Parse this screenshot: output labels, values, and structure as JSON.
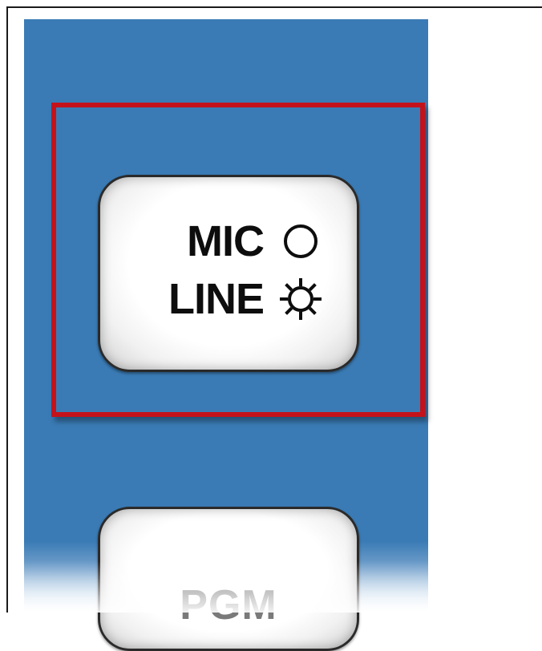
{
  "panel": {
    "background_color": "#3a7bb5",
    "highlight_color": "#c4121b"
  },
  "mic_line_button": {
    "rows": [
      {
        "label": "MIC",
        "indicator_icon": "led-off-circle-icon"
      },
      {
        "label": "LINE",
        "indicator_icon": "led-on-sun-icon"
      }
    ]
  },
  "pgm_button": {
    "label": "PGM"
  }
}
